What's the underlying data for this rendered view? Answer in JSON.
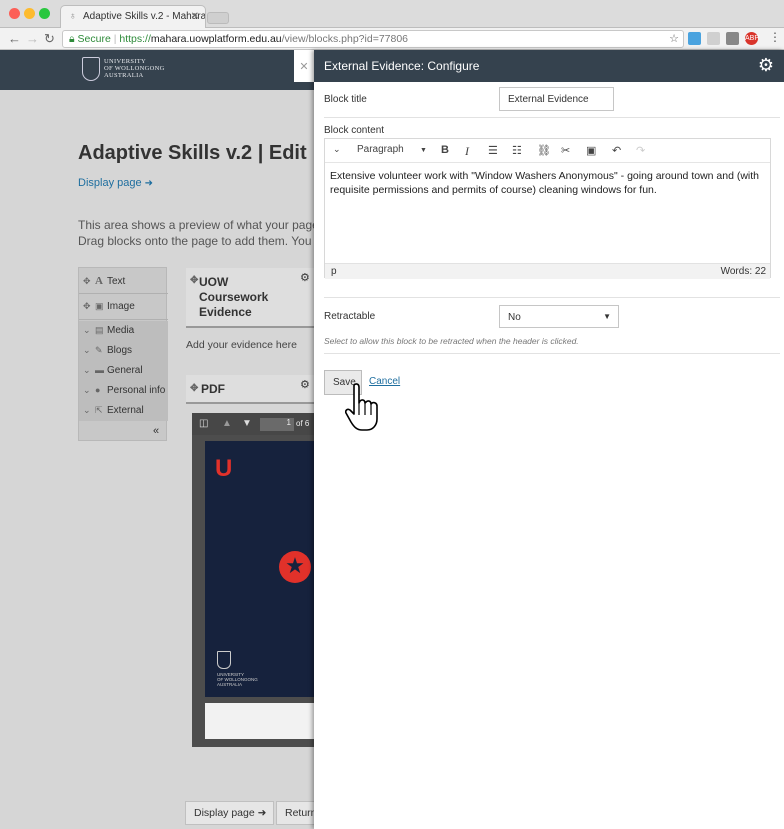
{
  "browser": {
    "tab_title": "Adaptive Skills v.2 - Mahara",
    "url_secure": "Secure",
    "url_https": "https://",
    "url_host": "mahara.uowplatform.edu.au",
    "url_path": "/view/blocks.php?id=77806",
    "ext_badge": "ABP"
  },
  "site": {
    "logo_line1": "UNIVERSITY",
    "logo_line2": "OF WOLLONGONG",
    "logo_line3": "AUSTRALIA"
  },
  "page": {
    "title": "Adaptive Skills v.2 | Edit",
    "display_link": "Display page",
    "intro_line1": "This area shows a preview of what your page lo",
    "intro_line2": "Drag blocks onto the page to add them. You ca"
  },
  "sidebar": {
    "items": [
      {
        "label": "Text",
        "icon": "A"
      },
      {
        "label": "Image",
        "icon": "▣"
      },
      {
        "label": "Media",
        "icon": "▤"
      },
      {
        "label": "Blogs",
        "icon": "✎"
      },
      {
        "label": "General",
        "icon": "▬"
      },
      {
        "label": "Personal info",
        "icon": "●"
      },
      {
        "label": "External",
        "icon": "⇱"
      }
    ],
    "collapse": "«"
  },
  "blocks": {
    "uow_title_1": "UOW",
    "uow_title_2": "Coursework",
    "uow_title_3": "Evidence",
    "add_evidence": "Add your evidence here",
    "pdf_title": "PDF",
    "pdf_page": "1",
    "pdf_of": "of 6"
  },
  "pdf_cover": {
    "letter": "U",
    "uni_line1": "UNIVERSITY",
    "uni_line2": "OF WOLLONGONG",
    "uni_line3": "AUSTRALIA"
  },
  "footer": {
    "display_page": "Display page",
    "return": "Return"
  },
  "panel": {
    "title": "External Evidence: Configure",
    "block_title_label": "Block title",
    "block_title_value": "External Evidence",
    "block_content_label": "Block content",
    "format_select": "Paragraph",
    "content_text": "Extensive volunteer work with \"Window Washers Anonymous\" - going around town and (with requisite permissions and permits of course) cleaning windows for fun.",
    "path": "p",
    "words": "Words: 22",
    "retractable_label": "Retractable",
    "retractable_value": "No",
    "retractable_hint": "Select to allow this block to be retracted when the header is clicked.",
    "save": "Save",
    "cancel": "Cancel"
  },
  "colors": {
    "header_bg": "#35424e",
    "link": "#1e6e9f",
    "accent_red": "#e1312a",
    "pdf_navy": "#16223d"
  }
}
